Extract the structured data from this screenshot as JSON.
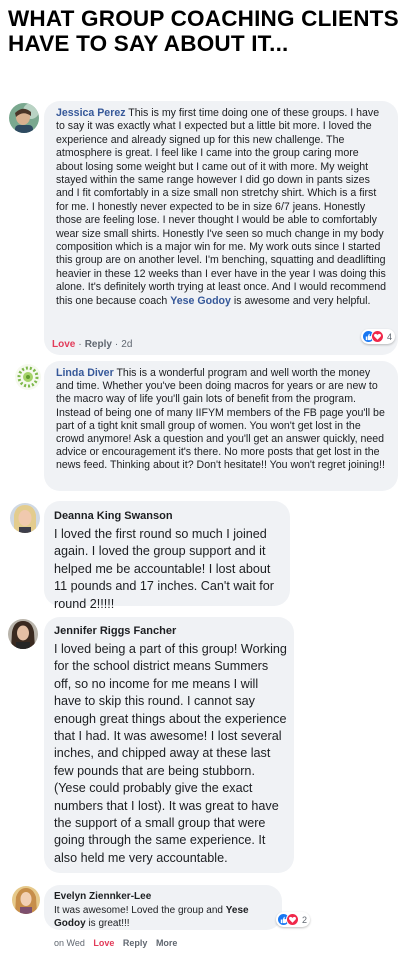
{
  "page": {
    "title": "WHAT GROUP COACHING CLIENTS HAVE TO SAY ABOUT IT..."
  },
  "comments": [
    {
      "author": "Jessica Perez",
      "text_before": " This is my first time doing one of these groups. I have to say it was exactly what I expected but a little bit more. I loved the experience and already signed up for this new challenge. The atmosphere is great. I feel like I came into the group caring more about losing some weight but I came out of it with more. My weight stayed within the same range however I did go down in pants sizes and I fit comfortably in a size small non stretchy shirt. Which is a first for me. I honestly never expected to be in size 6/7 jeans. Honestly those are feeling lose. I never thought I would be able to comfortably wear size small shirts. Honestly I've seen so much change in my body composition which is a major win for me. My work outs since I started this group are on another level. I'm benching, squatting and deadlifting heavier in these 12 weeks than I ever have in the year I was doing this alone. It's definitely worth trying at least once. And I would recommend this one because coach ",
      "mention": "Yese Godoy",
      "text_after": " is awesome and very helpful.",
      "actions": {
        "love": "Love",
        "sep": "·",
        "reply": "Reply",
        "time": "2d"
      },
      "reaction_count": "4",
      "reaction_icons": [
        "like-icon",
        "love-icon"
      ]
    },
    {
      "author": "Linda Diver",
      "text": " This is a wonderful program and well worth the money and time. Whether you've been doing macros for years or are new to the macro way of life you'll gain lots of benefit from the program. Instead of being one of many IIFYM members of the FB page you'll be part of a tight knit small group of women. You won't get lost in the crowd anymore! Ask a question and you'll get an answer quickly, need advice or encouragement it's there. No more posts that get lost in the news feed. Thinking about it? Don't hesitate!! You won't regret joining!!"
    },
    {
      "author": "Deanna King Swanson",
      "text": "I loved the first round so much I joined again. I loved the group support and it helped me be accountable! I lost about 11 pounds and 17 inches. Can't wait for round 2!!!!!"
    },
    {
      "author": "Jennifer Riggs Fancher",
      "text": "I loved being a part of this group! Working for the school district means Summers off, so no income for me means I will have to skip this round. I cannot say enough great things about the experience that I had. It was awesome! I lost several inches, and chipped away at these last few pounds that are being stubborn. (Yese could probably give the exact numbers that I lost). It was great to have the support of a small group that were going through the same experience. It also held me very accountable."
    },
    {
      "author": "Evelyn Ziennker-Lee",
      "text_before": "It was awesome! Loved the group and ",
      "mention": "Yese Godoy",
      "text_after": " is great!!!",
      "actions": {
        "time": "on Wed",
        "love": "Love",
        "reply": "Reply",
        "more": "More"
      },
      "reaction_count": "2",
      "reaction_icons": [
        "like-icon",
        "love-icon"
      ]
    }
  ],
  "colors": {
    "bubble": "#f0f2f5",
    "author_link": "#365899",
    "love": "#e23c5a",
    "like": "#1877f2",
    "heart": "#f0284a"
  }
}
